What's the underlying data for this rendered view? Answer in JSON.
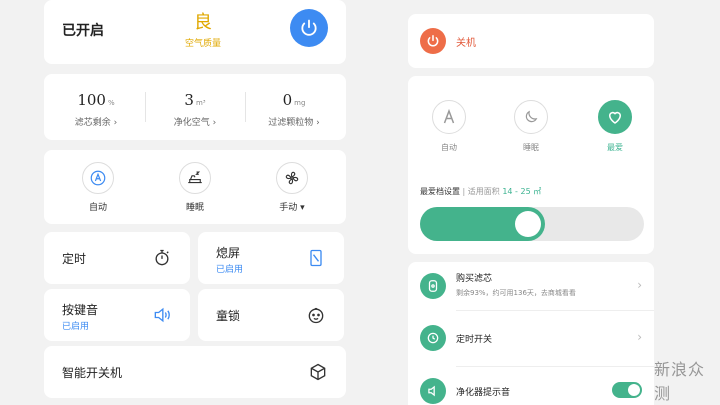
{
  "status": {
    "text": "已开启",
    "aq_value": "良",
    "aq_label": "空气质量"
  },
  "stats": [
    {
      "value": "100",
      "unit": "%",
      "label": "滤芯剩余 ›"
    },
    {
      "value": "3",
      "unit": "m³",
      "label": "净化空气 ›"
    },
    {
      "value": "0",
      "unit": "mg",
      "label": "过滤颗粒物 ›"
    }
  ],
  "modes": [
    {
      "label": "自动",
      "icon": "auto-icon"
    },
    {
      "label": "睡眠",
      "icon": "sleep-icon"
    },
    {
      "label": "手动 ▾",
      "icon": "fan-icon"
    }
  ],
  "tiles": {
    "timer": {
      "title": "定时",
      "icon": "stopwatch-icon"
    },
    "screen": {
      "title": "熄屏",
      "sub": "已启用",
      "icon": "screen-icon"
    },
    "sound": {
      "title": "按键音",
      "sub": "已启用",
      "icon": "speaker-icon"
    },
    "lock": {
      "title": "童锁",
      "icon": "baby-face-icon"
    }
  },
  "smart": {
    "title": "智能开关机",
    "icon": "cube-icon"
  },
  "right": {
    "off_label": "关机",
    "modes": [
      {
        "label": "自动",
        "icon": "auto-icon"
      },
      {
        "label": "睡眠",
        "icon": "sleep-icon"
      },
      {
        "label": "最爱",
        "icon": "heart-icon"
      }
    ],
    "fav_setting_a": "最爱档设置",
    "fav_setting_b": " | 适用面积 ",
    "fav_setting_c": "14 - 25 ㎡",
    "slider_level": 0.56,
    "list": [
      {
        "title": "购买滤芯",
        "sub": "剩余93%，约可用136天，去商城看看"
      },
      {
        "title": "定时开关"
      },
      {
        "title": "净化器提示音",
        "toggle_on": true
      }
    ]
  },
  "watermark": "新浪众测",
  "colors": {
    "accent_blue": "#3d8bf2",
    "accent_green": "#44b38c",
    "off_red": "#ee6d48",
    "aq_yellow": "#e0a800"
  }
}
